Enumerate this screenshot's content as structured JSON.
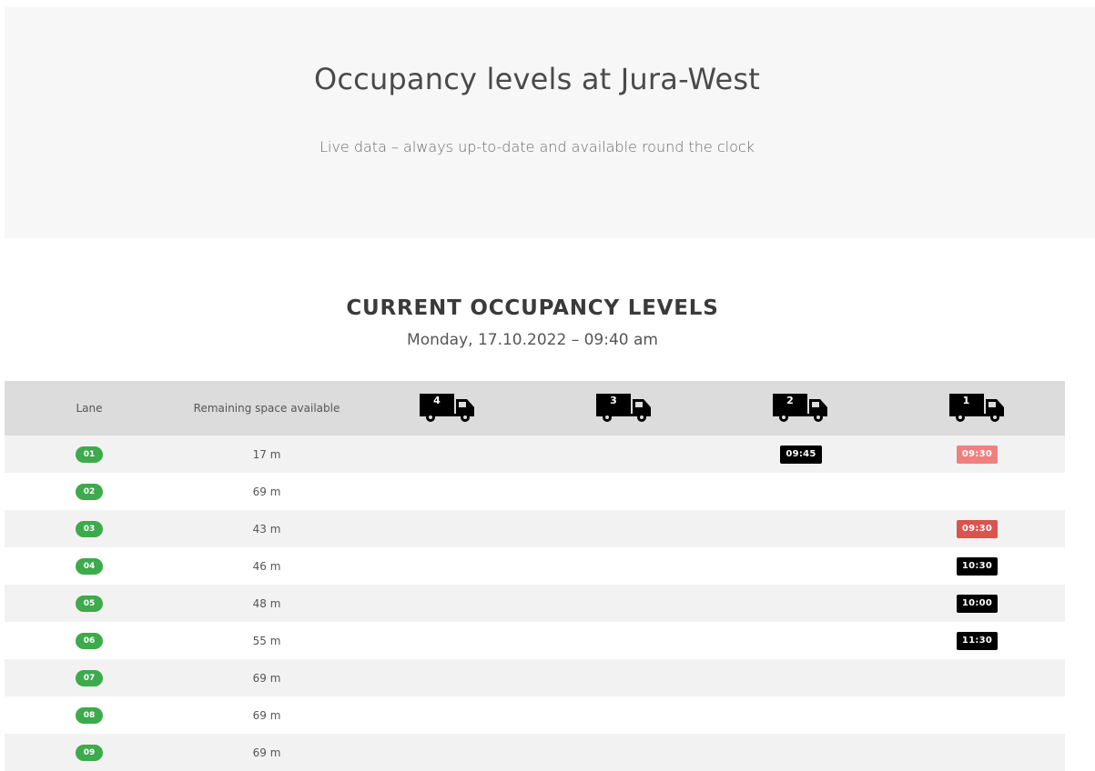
{
  "hero": {
    "title": "Occupancy levels at Jura-West",
    "subtitle": "Live data – always up-to-date and available round the clock"
  },
  "section": {
    "title": "CURRENT OCCUPANCY LEVELS",
    "date": "Monday, 17.10.2022 – 09:40 am"
  },
  "table": {
    "headers": {
      "lane": "Lane",
      "space": "Remaining space available",
      "trucks": [
        "4",
        "3",
        "2",
        "1"
      ]
    },
    "icon": "truck-icon",
    "rows": [
      {
        "lane": "01",
        "space": "17 m",
        "t2": "09:45",
        "t1": "09:30",
        "t1_style": "light-red"
      },
      {
        "lane": "02",
        "space": "69 m"
      },
      {
        "lane": "03",
        "space": "43 m",
        "t1": "09:30",
        "t1_style": "red"
      },
      {
        "lane": "04",
        "space": "46 m",
        "t1": "10:30",
        "t1_style": "black"
      },
      {
        "lane": "05",
        "space": "48 m",
        "t1": "10:00",
        "t1_style": "black"
      },
      {
        "lane": "06",
        "space": "55 m",
        "t1": "11:30",
        "t1_style": "black"
      },
      {
        "lane": "07",
        "space": "69 m"
      },
      {
        "lane": "08",
        "space": "69 m"
      },
      {
        "lane": "09",
        "space": "69 m"
      }
    ]
  },
  "colors": {
    "lane_badge": "#3daa4c",
    "time_black": "#000000",
    "time_red": "#d9534f",
    "time_light_red": "#f08080",
    "header_bg": "#dcdcdc",
    "row_alt": "#f2f2f2"
  }
}
